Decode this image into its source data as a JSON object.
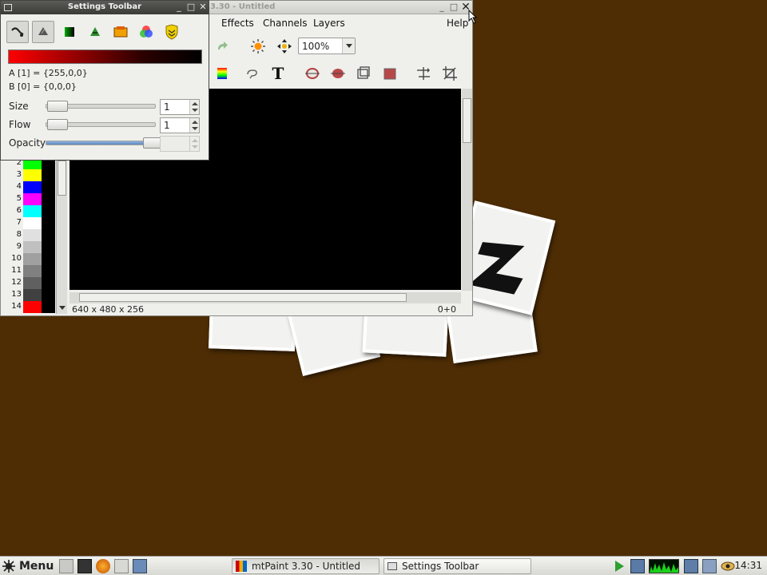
{
  "main_window": {
    "title": "3.30 - Untitled",
    "menu": [
      "Effects",
      "Channels",
      "Layers",
      "Help"
    ],
    "zoom": "100%",
    "status_size": "640 x 480 x 256",
    "status_pos": "0+0"
  },
  "palette": [
    {
      "index": "2",
      "color": "#00ff00"
    },
    {
      "index": "3",
      "color": "#ffff00"
    },
    {
      "index": "4",
      "color": "#0000ff"
    },
    {
      "index": "5",
      "color": "#ff00ff"
    },
    {
      "index": "6",
      "color": "#00ffff"
    },
    {
      "index": "7",
      "color": "#ffffff"
    },
    {
      "index": "8",
      "color": "#e0e0e0"
    },
    {
      "index": "9",
      "color": "#c0c0c0"
    },
    {
      "index": "10",
      "color": "#a0a0a0"
    },
    {
      "index": "11",
      "color": "#808080"
    },
    {
      "index": "12",
      "color": "#606060"
    },
    {
      "index": "13",
      "color": "#404040"
    },
    {
      "index": "14",
      "color": "#ff0000"
    }
  ],
  "settings_toolbar": {
    "title": "Settings Toolbar",
    "color_a": "A [1] = {255,0,0}",
    "color_b": "B [0] = {0,0,0}",
    "size_label": "Size",
    "size_value": "1",
    "size_level": 0.03,
    "flow_label": "Flow",
    "flow_value": "1",
    "flow_level": 0.03,
    "opacity_label": "Opacity",
    "opacity_level": 1.0
  },
  "taskbar": {
    "menu_label": "Menu",
    "tasks": [
      "mtPaint 3.30 - Untitled",
      "Settings Toolbar"
    ],
    "clock": "14:31"
  },
  "colors": {
    "desktop": "#4e2d05",
    "canvas": "#000000",
    "color_a": "#ff0000",
    "color_b": "#000000"
  }
}
